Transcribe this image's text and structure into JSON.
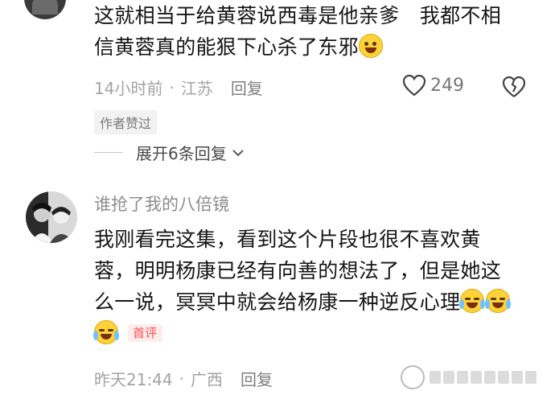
{
  "comment1": {
    "text": "这就相当于给黄蓉说西毒是他亲爹　我都不相信黄蓉真的能狠下心杀了东邪",
    "emoji": "blush-emoji",
    "time": "14小时前",
    "location": "江苏",
    "reply_label": "回复",
    "like_count": "249",
    "author_liked": "作者赞过",
    "expand_label": "展开6条回复"
  },
  "comment2": {
    "username": "谁抢了我的八倍镜",
    "text": "我刚看完这集，看到这个片段也很不喜欢黄蓉，明明杨康已经有向善的想法了，但是她这么一说，冥冥中就会给杨康一种逆反心理",
    "emojis": [
      "tears-of-joy-emoji",
      "tears-of-joy-emoji",
      "tears-of-joy-emoji"
    ],
    "badge": "首评",
    "time": "昨天21:44",
    "location": "广西",
    "reply_label": "回复"
  },
  "colors": {
    "text": "#161616",
    "meta": "#a3a3a3",
    "badge_red": "#ff4d4f",
    "emoji_yellow": "#ffd23a"
  }
}
